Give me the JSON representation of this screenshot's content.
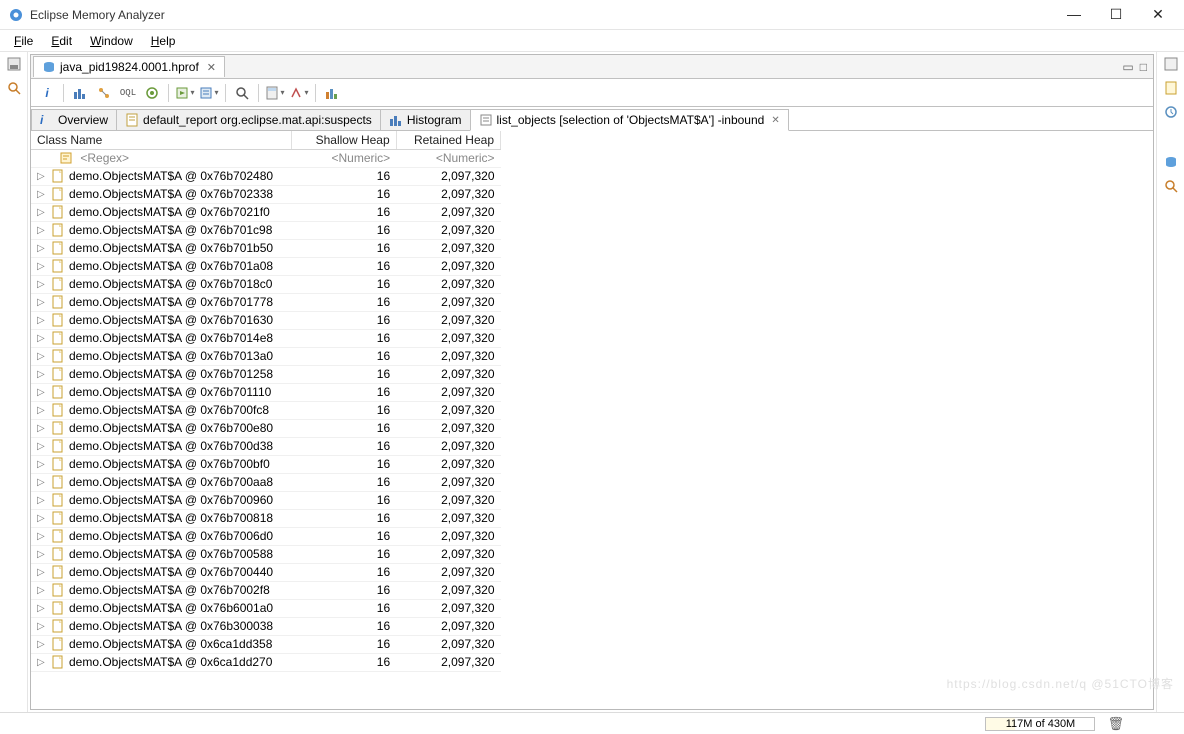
{
  "app": {
    "title": "Eclipse Memory Analyzer"
  },
  "menu": {
    "file": "File",
    "edit": "Edit",
    "window": "Window",
    "help": "Help"
  },
  "editor_tab": {
    "label": "java_pid19824.0001.hprof"
  },
  "inner_tabs": {
    "overview": "Overview",
    "default_report": "default_report  org.eclipse.mat.api:suspects",
    "histogram": "Histogram",
    "list_objects": "list_objects [selection of 'ObjectsMAT$A'] -inbound"
  },
  "columns": {
    "name": "Class Name",
    "shallow": "Shallow Heap",
    "retained": "Retained Heap"
  },
  "regex_placeholder": "<Regex>",
  "numeric_placeholder": "<Numeric>",
  "rows": [
    {
      "name": "demo.ObjectsMAT$A @ 0x76b702480",
      "shallow": "16",
      "retained": "2,097,320"
    },
    {
      "name": "demo.ObjectsMAT$A @ 0x76b702338",
      "shallow": "16",
      "retained": "2,097,320"
    },
    {
      "name": "demo.ObjectsMAT$A @ 0x76b7021f0",
      "shallow": "16",
      "retained": "2,097,320"
    },
    {
      "name": "demo.ObjectsMAT$A @ 0x76b701c98",
      "shallow": "16",
      "retained": "2,097,320"
    },
    {
      "name": "demo.ObjectsMAT$A @ 0x76b701b50",
      "shallow": "16",
      "retained": "2,097,320"
    },
    {
      "name": "demo.ObjectsMAT$A @ 0x76b701a08",
      "shallow": "16",
      "retained": "2,097,320"
    },
    {
      "name": "demo.ObjectsMAT$A @ 0x76b7018c0",
      "shallow": "16",
      "retained": "2,097,320"
    },
    {
      "name": "demo.ObjectsMAT$A @ 0x76b701778",
      "shallow": "16",
      "retained": "2,097,320"
    },
    {
      "name": "demo.ObjectsMAT$A @ 0x76b701630",
      "shallow": "16",
      "retained": "2,097,320"
    },
    {
      "name": "demo.ObjectsMAT$A @ 0x76b7014e8",
      "shallow": "16",
      "retained": "2,097,320"
    },
    {
      "name": "demo.ObjectsMAT$A @ 0x76b7013a0",
      "shallow": "16",
      "retained": "2,097,320"
    },
    {
      "name": "demo.ObjectsMAT$A @ 0x76b701258",
      "shallow": "16",
      "retained": "2,097,320"
    },
    {
      "name": "demo.ObjectsMAT$A @ 0x76b701110",
      "shallow": "16",
      "retained": "2,097,320"
    },
    {
      "name": "demo.ObjectsMAT$A @ 0x76b700fc8",
      "shallow": "16",
      "retained": "2,097,320"
    },
    {
      "name": "demo.ObjectsMAT$A @ 0x76b700e80",
      "shallow": "16",
      "retained": "2,097,320"
    },
    {
      "name": "demo.ObjectsMAT$A @ 0x76b700d38",
      "shallow": "16",
      "retained": "2,097,320"
    },
    {
      "name": "demo.ObjectsMAT$A @ 0x76b700bf0",
      "shallow": "16",
      "retained": "2,097,320"
    },
    {
      "name": "demo.ObjectsMAT$A @ 0x76b700aa8",
      "shallow": "16",
      "retained": "2,097,320"
    },
    {
      "name": "demo.ObjectsMAT$A @ 0x76b700960",
      "shallow": "16",
      "retained": "2,097,320"
    },
    {
      "name": "demo.ObjectsMAT$A @ 0x76b700818",
      "shallow": "16",
      "retained": "2,097,320"
    },
    {
      "name": "demo.ObjectsMAT$A @ 0x76b7006d0",
      "shallow": "16",
      "retained": "2,097,320"
    },
    {
      "name": "demo.ObjectsMAT$A @ 0x76b700588",
      "shallow": "16",
      "retained": "2,097,320"
    },
    {
      "name": "demo.ObjectsMAT$A @ 0x76b700440",
      "shallow": "16",
      "retained": "2,097,320"
    },
    {
      "name": "demo.ObjectsMAT$A @ 0x76b7002f8",
      "shallow": "16",
      "retained": "2,097,320"
    },
    {
      "name": "demo.ObjectsMAT$A @ 0x76b6001a0",
      "shallow": "16",
      "retained": "2,097,320"
    },
    {
      "name": "demo.ObjectsMAT$A @ 0x76b300038",
      "shallow": "16",
      "retained": "2,097,320"
    },
    {
      "name": "demo.ObjectsMAT$A @ 0x6ca1dd358",
      "shallow": "16",
      "retained": "2,097,320"
    },
    {
      "name": "demo.ObjectsMAT$A @ 0x6ca1dd270",
      "shallow": "16",
      "retained": "2,097,320"
    }
  ],
  "status": {
    "memory": "117M of 430M"
  },
  "watermark": "https://blog.csdn.net/q   @51CTO博客"
}
